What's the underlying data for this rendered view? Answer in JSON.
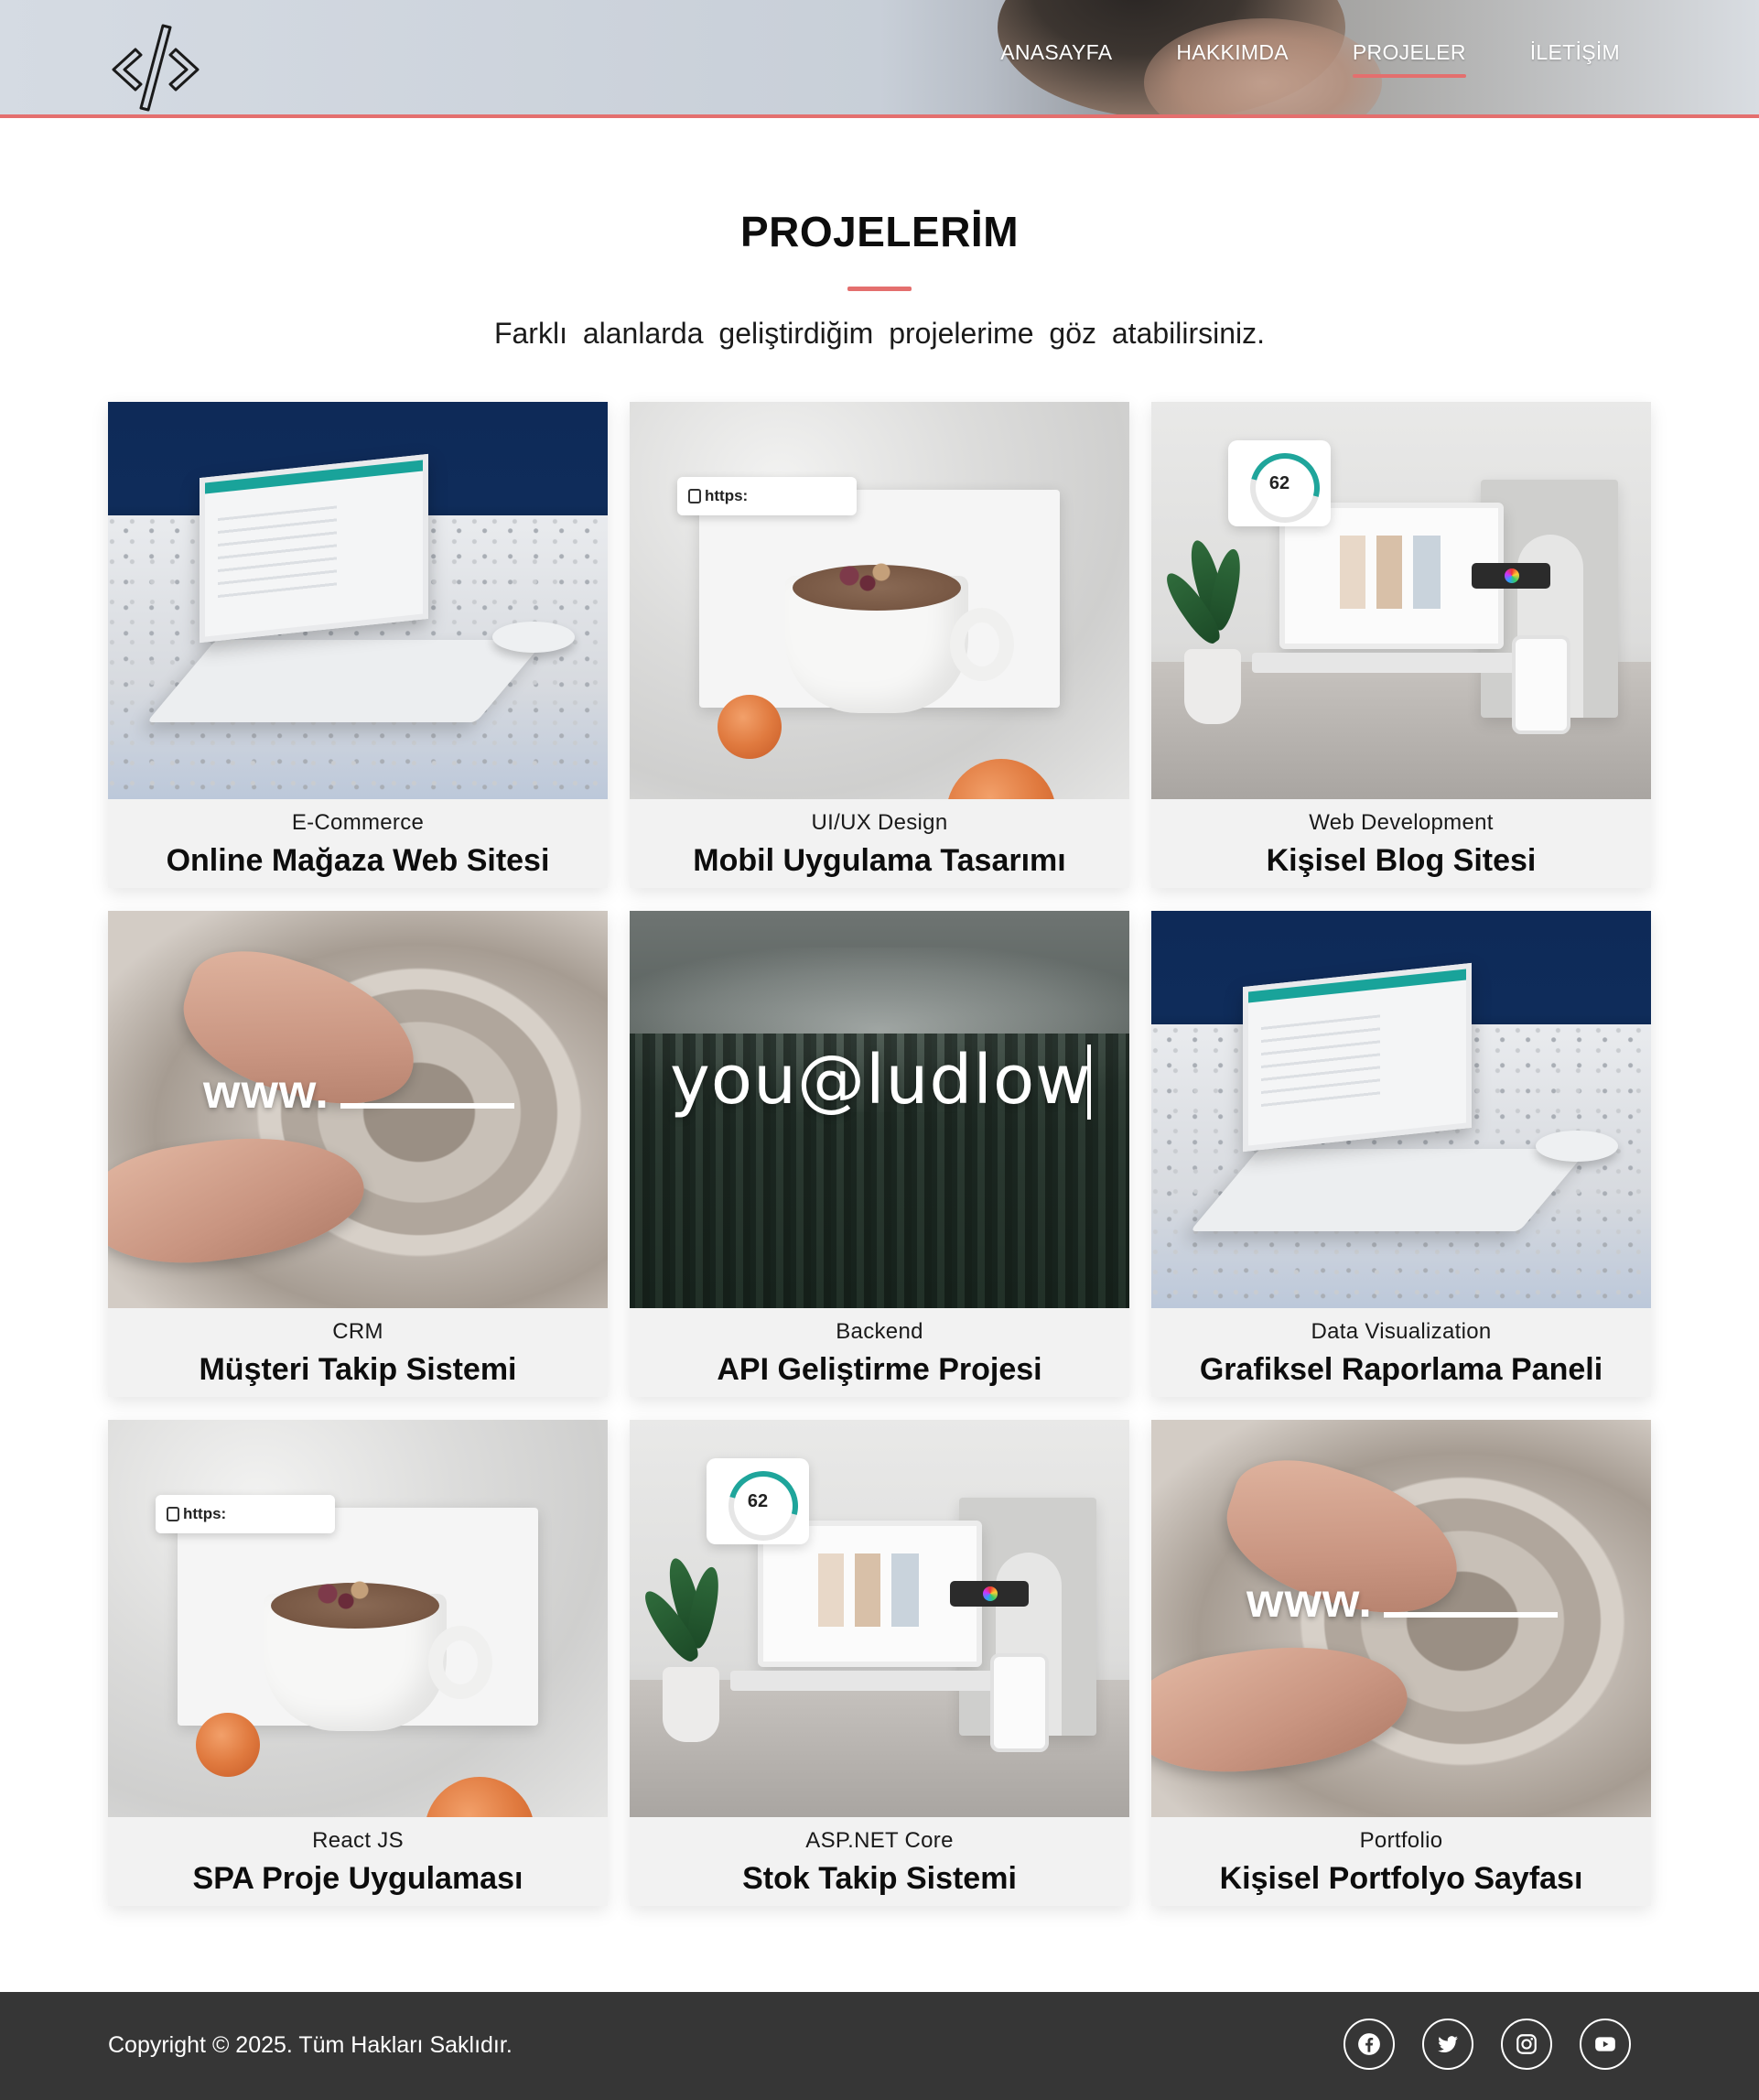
{
  "nav": {
    "items": [
      "ANASAYFA",
      "HAKKIMDA",
      "PROJELER",
      "İLETİŞİM"
    ],
    "active": "PROJELER"
  },
  "section": {
    "title": "PROJELERİM",
    "subtitle": "Farklı alanlarda geliştirdiğim projelerime göz atabilirsiniz."
  },
  "projects": [
    {
      "category": "E-Commerce",
      "title": "Online Mağaza Web Sitesi"
    },
    {
      "category": "UI/UX Design",
      "title": "Mobil Uygulama Tasarımı",
      "image_text": "https:"
    },
    {
      "category": "Web Development",
      "title": "Kişisel Blog Sitesi",
      "image_text": "62"
    },
    {
      "category": "CRM",
      "title": "Müşteri Takip Sistemi",
      "image_text": "www."
    },
    {
      "category": "Backend",
      "title": "API Geliştirme Projesi",
      "image_text": "you@ludlow"
    },
    {
      "category": "Data Visualization",
      "title": "Grafiksel Raporlama Paneli"
    },
    {
      "category": "React JS",
      "title": "SPA Proje Uygulaması",
      "image_text": "https:"
    },
    {
      "category": "ASP.NET Core",
      "title": "Stok Takip Sistemi",
      "image_text": "62"
    },
    {
      "category": "Portfolio",
      "title": "Kişisel Portfolyo Sayfası",
      "image_text": "www."
    }
  ],
  "footer": {
    "copyright": "Copyright © 2025. Tüm Hakları Saklıdır.",
    "socials": [
      "facebook-icon",
      "twitter-icon",
      "instagram-icon",
      "youtube-icon"
    ]
  },
  "colors": {
    "accent": "#e46f6e",
    "footer_bg": "#363636",
    "card_bg": "#f2f2f2"
  }
}
